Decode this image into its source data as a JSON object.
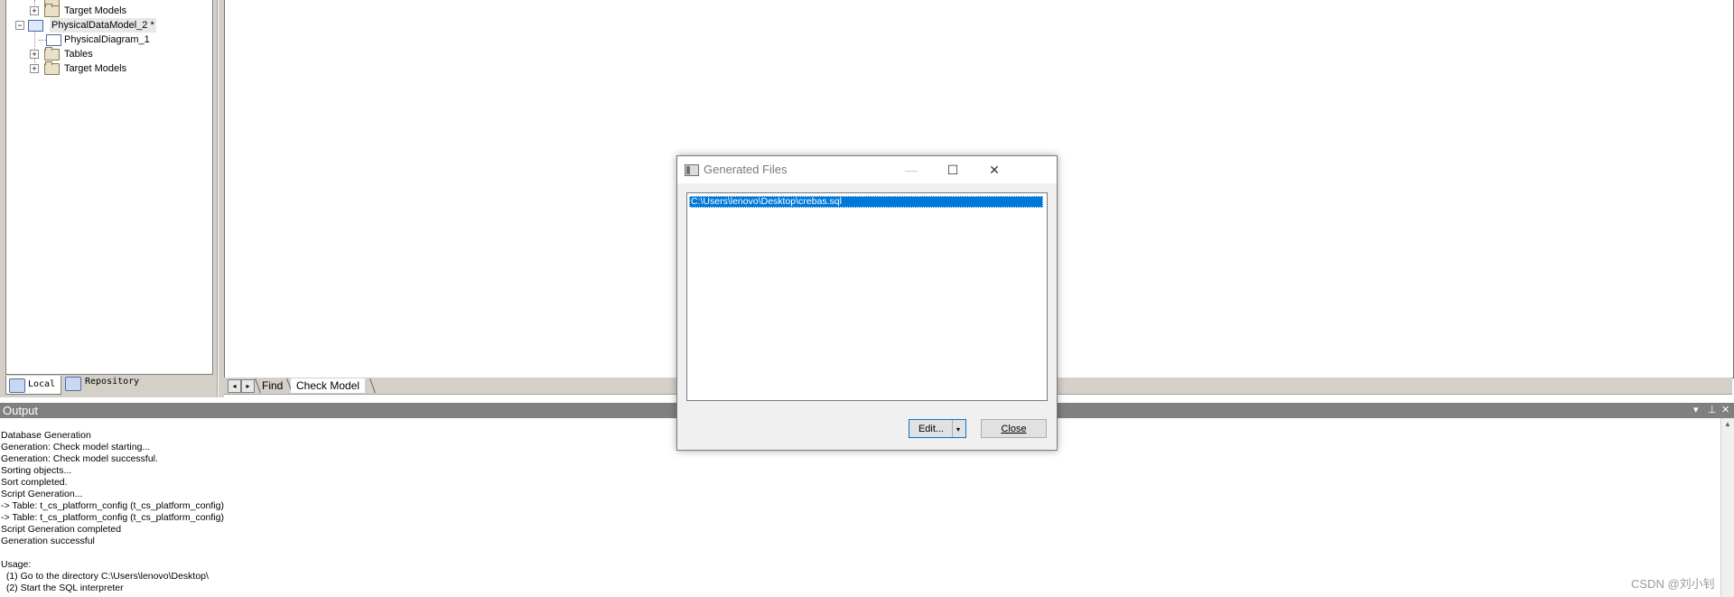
{
  "browser": {
    "tree": [
      {
        "label": "Target Models",
        "kind": "folder"
      },
      {
        "label": "PhysicalDataModel_2 *",
        "kind": "model"
      },
      {
        "label": "PhysicalDiagram_1",
        "kind": "diagram"
      },
      {
        "label": "Tables",
        "kind": "folder"
      },
      {
        "label": "Target Models",
        "kind": "folder"
      }
    ],
    "tabs": [
      {
        "label": "Local",
        "icon": "local-icon"
      },
      {
        "label": "Repository",
        "icon": "repository-icon"
      }
    ]
  },
  "workspace": {
    "tabs": [
      "Find",
      "Check Model"
    ]
  },
  "output": {
    "title": "Output",
    "lines": [
      "Database Generation",
      "Generation: Check model starting...",
      "Generation: Check model successful.",
      "Sorting objects...",
      "Sort completed.",
      "Script Generation...",
      "-> Table: t_cs_platform_config (t_cs_platform_config)",
      "-> Table: t_cs_platform_config (t_cs_platform_config)",
      "Script Generation completed",
      "Generation successful",
      "",
      "Usage:",
      "  (1) Go to the directory C:\\Users\\lenovo\\Desktop\\",
      "  (2) Start the SQL interpreter"
    ]
  },
  "dialog": {
    "title": "Generated Files",
    "files": [
      "C:\\Users\\lenovo\\Desktop\\crebas.sql"
    ],
    "edit_label": "Edit...",
    "close_label": "Close"
  },
  "watermark": "CSDN @刘小钊"
}
